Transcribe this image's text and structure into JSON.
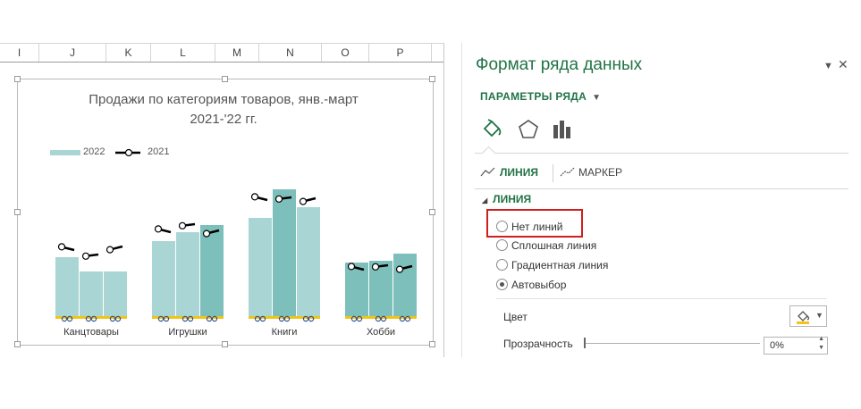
{
  "spreadsheet": {
    "columns": [
      "I",
      "J",
      "K",
      "L",
      "M",
      "N",
      "O",
      "P"
    ]
  },
  "chart": {
    "title_line1": "Продажи по категориям товаров, янв.-март",
    "title_line2": "2021-'22 гг.",
    "legend": {
      "series_bar": "2022",
      "series_line": "2021"
    },
    "colors": {
      "bar_light": "#a9d5d4",
      "bar_dark": "#7dbfbb",
      "line": "#000000",
      "gold": "#f2c418",
      "handle_blue": "#2f5597"
    }
  },
  "chart_data": {
    "type": "bar",
    "title": "Продажи по категориям товаров, янв.-март 2021-'22 гг.",
    "categories": [
      "Канцтовары",
      "Игрушки",
      "Книги",
      "Хобби"
    ],
    "series": [
      {
        "name": "2022",
        "type": "bar",
        "values": [
          [
            34,
            26,
            26
          ],
          [
            43,
            48,
            52
          ],
          [
            56,
            72,
            62
          ],
          [
            31,
            32,
            36
          ]
        ]
      },
      {
        "name": "2021",
        "type": "line",
        "values": [
          [
            39,
            35,
            39
          ],
          [
            49,
            52,
            48
          ],
          [
            67,
            67,
            66
          ],
          [
            28,
            29,
            28
          ]
        ]
      }
    ],
    "ylim": [
      0,
      80
    ],
    "legend_position": "top-left",
    "grid": false
  },
  "panel": {
    "title": "Формат ряда данных",
    "params_label": "ПАРАМЕТРЫ РЯДА",
    "subtab_line": "ЛИНИЯ",
    "subtab_marker": "МАРКЕР",
    "section_line": "ЛИНИЯ",
    "options": [
      {
        "label": "Нет линий",
        "checked": false
      },
      {
        "label": "Сплошная линия",
        "checked": false
      },
      {
        "label": "Градиентная линия",
        "checked": false
      },
      {
        "label": "Автовыбор",
        "checked": true
      }
    ],
    "color_label": "Цвет",
    "transparency_label": "Прозрачность",
    "transparency_value": "0%",
    "accent": "#217346"
  }
}
